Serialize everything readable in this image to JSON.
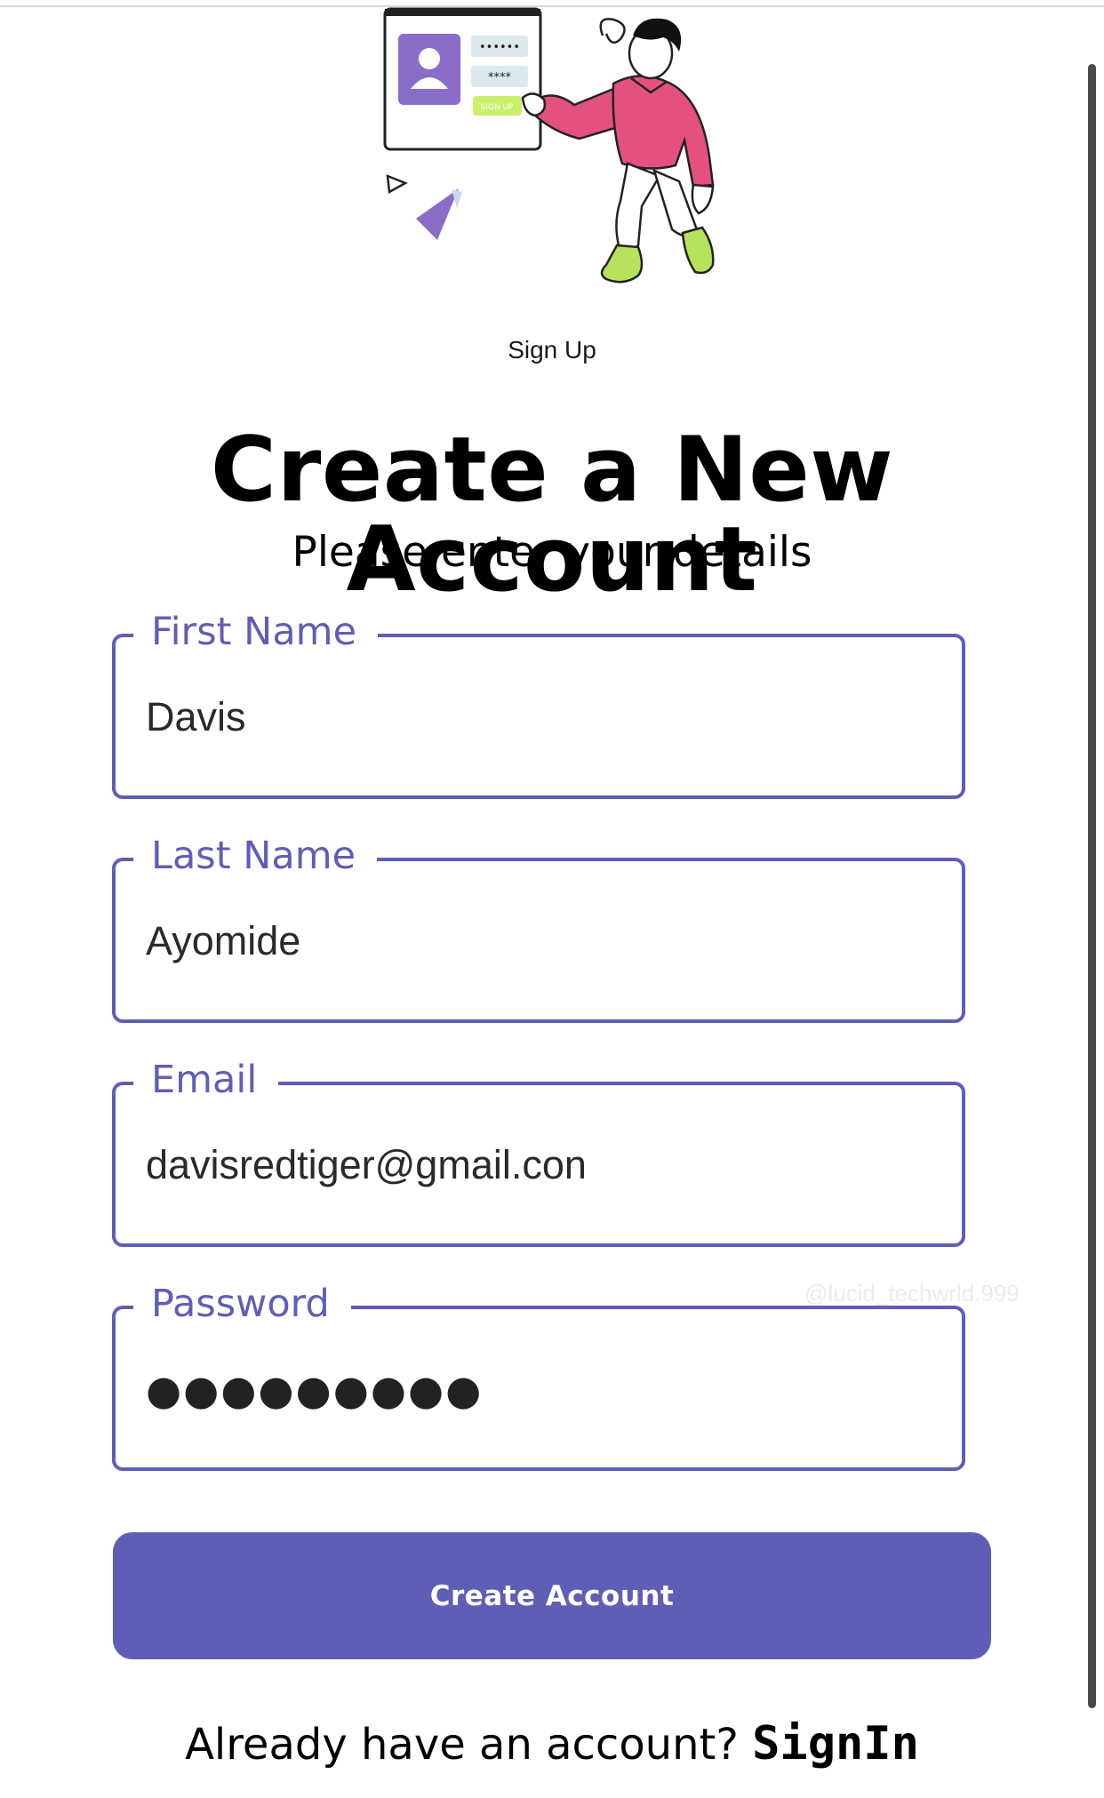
{
  "hero": {
    "illustration_icon": "person-signup-illustration",
    "card_password_mask_1": "••••••",
    "card_password_mask_2": "****",
    "card_button_label": "SIGN UP",
    "caption": "Sign Up"
  },
  "header": {
    "title": "Create a New Account",
    "subtitle": "Please enter your details"
  },
  "form": {
    "first_name": {
      "label": "First Name",
      "value": "Davis"
    },
    "last_name": {
      "label": "Last Name",
      "value": "Ayomide"
    },
    "email": {
      "label": "Email",
      "value": "davisredtiger@gmail.con"
    },
    "password": {
      "label": "Password",
      "masked_value": "●●●●●●●●●",
      "length": 9
    }
  },
  "actions": {
    "create_account_label": "Create Account"
  },
  "footer": {
    "prompt": "Already have an account? ",
    "signin_label": "SignIn"
  },
  "watermark": "@lucid_techwrld.999",
  "colors": {
    "accent": "#5f5eb7",
    "illustration_pink": "#e4517f",
    "illustration_purple": "#8a6cc9",
    "illustration_green": "#b6e35b"
  }
}
